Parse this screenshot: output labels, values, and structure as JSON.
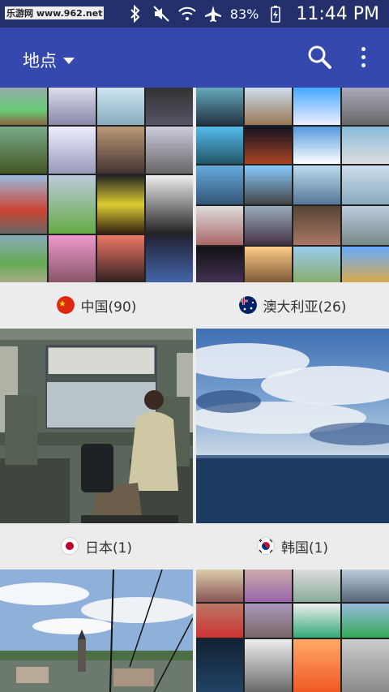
{
  "status_bar": {
    "watermark": "乐游网 www.962.net",
    "battery": "83%",
    "time": "11:44 PM",
    "icons": [
      "bluetooth-icon",
      "mute-icon",
      "wifi-icon",
      "airplane-icon",
      "battery-icon"
    ]
  },
  "app_bar": {
    "title": "地点",
    "icons": [
      "dropdown-caret-icon",
      "search-icon",
      "more-vert-icon"
    ]
  },
  "locations": [
    {
      "label": "中国(90)",
      "flag": "china-flag-icon"
    },
    {
      "label": "澳大利亚(26)",
      "flag": "australia-flag-icon"
    },
    {
      "label": "日本(1)",
      "flag": "japan-flag-icon"
    },
    {
      "label": "韩国(1)",
      "flag": "korea-flag-icon"
    },
    {
      "label": "",
      "flag": ""
    },
    {
      "label": "",
      "flag": ""
    }
  ],
  "colors": {
    "status_bar": "#23306b",
    "app_bar": "#3448ad",
    "background": "#ececec"
  }
}
